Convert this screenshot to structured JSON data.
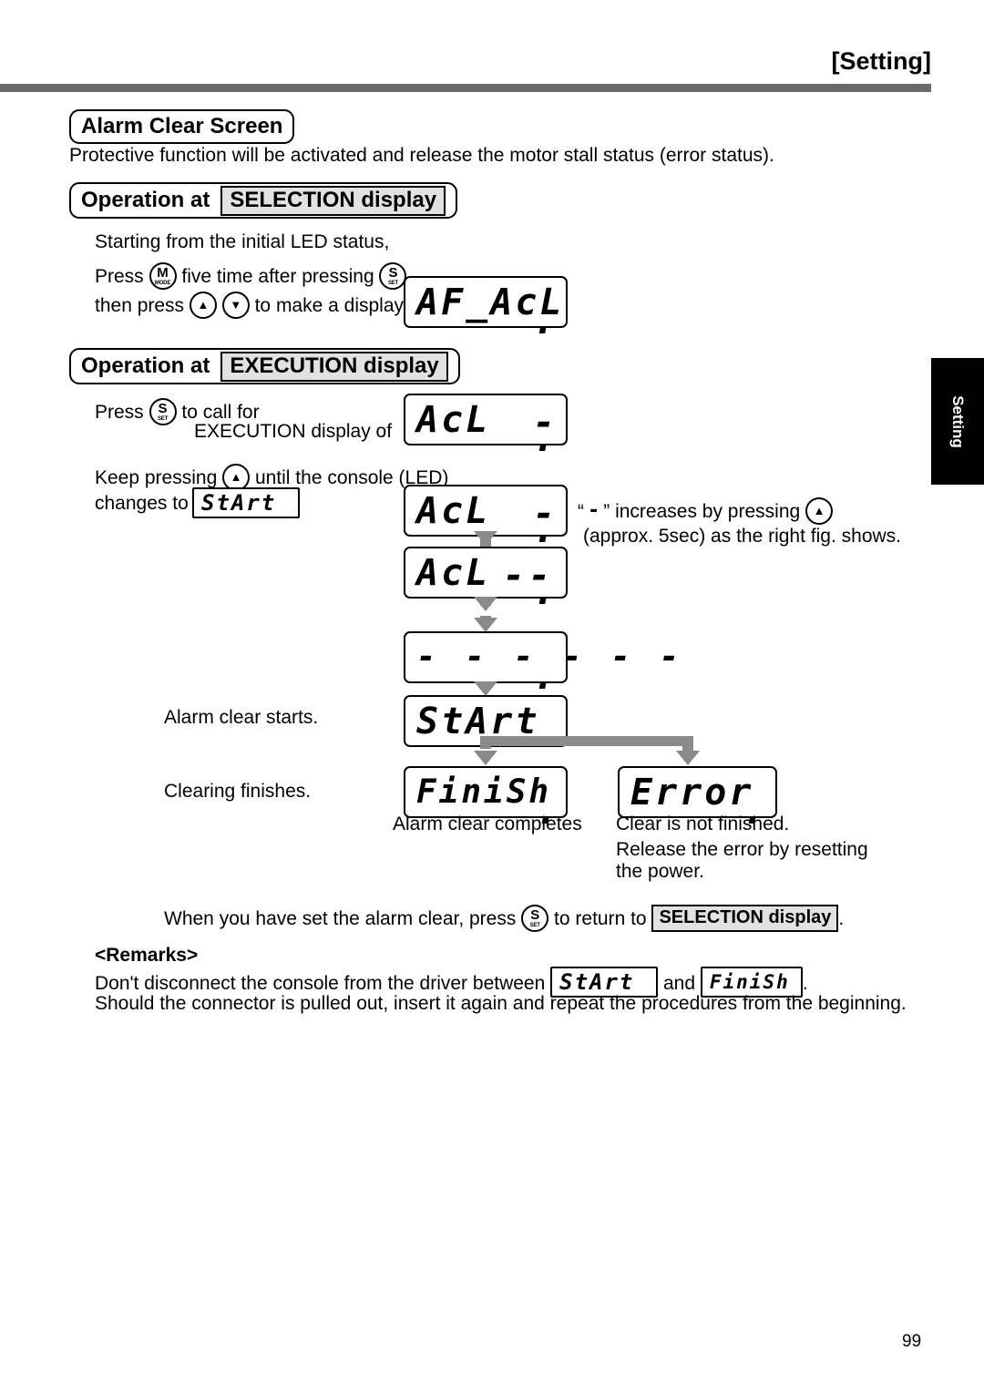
{
  "header": {
    "title": "[Setting]"
  },
  "side_tab": {
    "label": "Setting"
  },
  "sections": {
    "alarm_clear": {
      "title": "Alarm Clear Screen",
      "description": "Protective function will be activated and release the motor stall status (error status)."
    },
    "selection": {
      "prefix": "Operation at",
      "highlight": "SELECTION display",
      "lines": {
        "starting": "Starting from the initial LED status,",
        "press_pre": "Press",
        "press_mid": "five time after pressing",
        "press_post": ",",
        "then_pre": "then press",
        "then_post": "to make a display to"
      },
      "led_af_acl": "AF_AcL"
    },
    "execution": {
      "prefix": "Operation at",
      "highlight": "EXECUTION display",
      "lines": {
        "press_pre": "Press",
        "press_post": "to call for",
        "exec_of": "EXECUTION display of",
        "keep_pre": "Keep pressing",
        "keep_post": "until the console (LED)",
        "changes_to": "changes to"
      },
      "led_acl_call": "AcL",
      "led_start_inline": "StArt"
    }
  },
  "flow": {
    "note_dash_pre": "“",
    "note_dash_char": "-",
    "note_dash_post": "” increases by pressing",
    "note_approx": "(approx. 5sec) as the right fig. shows.",
    "steps": [
      {
        "label": "",
        "led": "AcL",
        "dashes": "-"
      },
      {
        "label": "",
        "led": "AcL",
        "dashes": "--"
      },
      {
        "label": "",
        "led": "",
        "dashes": "- - - - - -"
      },
      {
        "label": "Alarm clear starts.",
        "led": "StArt",
        "dashes": ""
      }
    ],
    "alarm_clear_starts": "Alarm clear starts.",
    "clearing_finishes": "Clearing finishes.",
    "led_start": "StArt",
    "led_finish": "FiniSh",
    "led_error": "Error",
    "caption_finish": "Alarm clear completes",
    "caption_error": "Clear is not finished.",
    "caption_error_2": "Release the error by resetting",
    "caption_error_3": "the power."
  },
  "footer_note": {
    "when_pre": "When you have set the alarm clear, press",
    "when_mid": "to return to",
    "when_highlight": "SELECTION display",
    "when_post": "."
  },
  "remarks": {
    "title": "<Remarks>",
    "line1_pre": "Don't disconnect the console from the driver between",
    "line1_led_a": "StArt",
    "line1_mid": "and",
    "line1_led_b": "FiniSh",
    "line1_post": ".",
    "line2": "Should the connector is pulled out, insert it again and repeat the procedures from the beginning."
  },
  "keys": {
    "mode": {
      "main": "M",
      "sub": "MODE"
    },
    "set": {
      "main": "S",
      "sub": "SET"
    },
    "up": {
      "main": "▲",
      "sub": ""
    },
    "down": {
      "main": "▼",
      "sub": ""
    }
  },
  "page_number": "99",
  "colors": {
    "rule": "#6b6b6b",
    "arrow": "#8a8a8a",
    "highlight_bg": "#e2e2e2",
    "tab_bg": "#000000"
  }
}
